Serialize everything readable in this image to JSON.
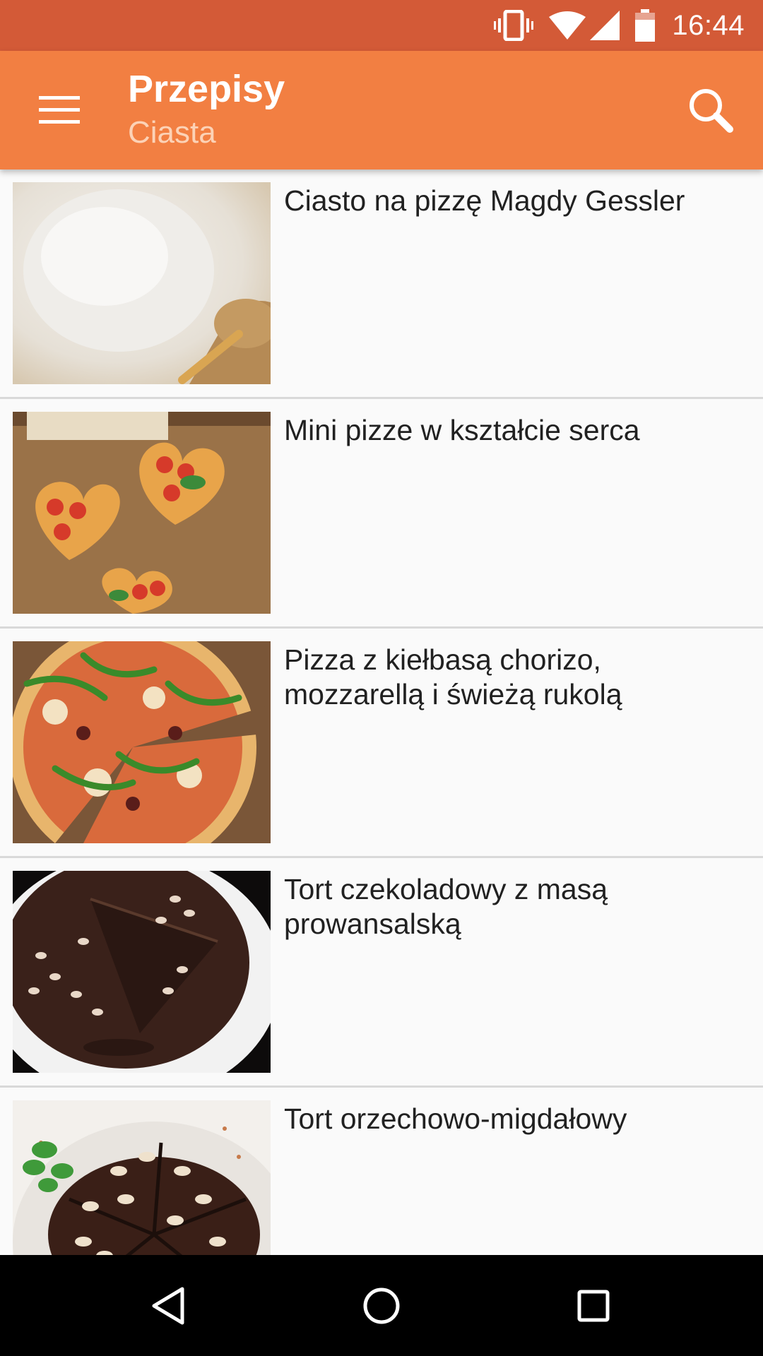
{
  "status_bar": {
    "time": "16:44",
    "icons": [
      "vibrate-icon",
      "wifi-icon",
      "signal-icon",
      "battery-icon"
    ]
  },
  "app_bar": {
    "title": "Przepisy",
    "subtitle": "Ciasta",
    "menu_icon": "hamburger-menu-icon",
    "search_icon": "search-icon"
  },
  "recipes": [
    {
      "title": "Ciasto na pizzę Magdy Gessler",
      "image": "pizza-dough-image"
    },
    {
      "title": "Mini pizze w kształcie serca",
      "image": "heart-pizza-image"
    },
    {
      "title": "Pizza z kiełbasą chorizo, mozzarellą i świeżą rukolą",
      "image": "chorizo-pizza-image"
    },
    {
      "title": "Tort czekoladowy z masą prowansalską",
      "image": "chocolate-cake-image"
    },
    {
      "title": "Tort orzechowo-migdałowy",
      "image": "nut-almond-cake-image"
    }
  ],
  "nav_bar": {
    "icons": [
      "back-icon",
      "home-icon",
      "recent-apps-icon"
    ]
  },
  "colors": {
    "status_bar": "#d35a37",
    "app_bar": "#f27f42",
    "subtitle": "#fcd2b6",
    "background": "#fafafa",
    "divider": "#d9d9d9"
  }
}
